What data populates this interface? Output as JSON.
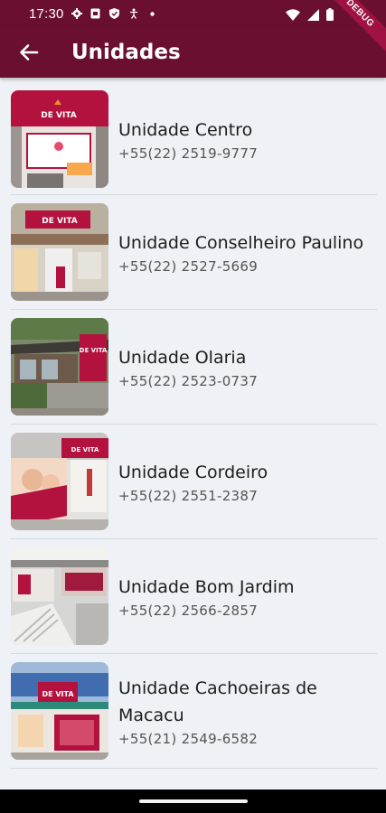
{
  "status_bar": {
    "time": "17:30",
    "left_icons": [
      "gear-icon",
      "sim-card-icon",
      "shield-icon",
      "accessibility-icon",
      "dot-icon"
    ],
    "right_icons": [
      "wifi-icon",
      "signal-icon",
      "battery-icon"
    ],
    "debug_label": "DEBUG"
  },
  "app_bar": {
    "back_icon": "arrow-left-icon",
    "title": "Unidades",
    "color": "#6b0f30"
  },
  "units": [
    {
      "name": "Unidade Centro",
      "phone": "+55(22) 2519-9777",
      "image": "storefront-centro"
    },
    {
      "name": "Unidade Conselheiro Paulino",
      "phone": "+55(22) 2527-5669",
      "image": "storefront-conselheiro-paulino"
    },
    {
      "name": "Unidade Olaria",
      "phone": "+55(22) 2523-0737",
      "image": "storefront-olaria"
    },
    {
      "name": "Unidade Cordeiro",
      "phone": "+55(22) 2551-2387",
      "image": "storefront-cordeiro"
    },
    {
      "name": "Unidade Bom Jardim",
      "phone": "+55(22) 2566-2857",
      "image": "storefront-bom-jardim"
    },
    {
      "name": "Unidade Cachoeiras de Macacu",
      "phone": "+55(21) 2549-6582",
      "image": "storefront-cachoeiras"
    }
  ],
  "photo_labels": {
    "brand_sign": "DE VITA"
  }
}
